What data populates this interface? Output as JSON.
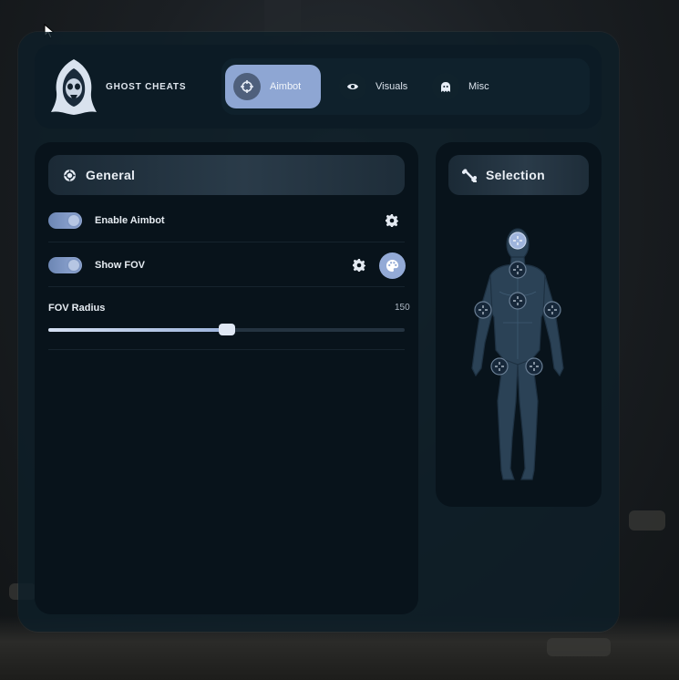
{
  "brand": {
    "name": "GHOST CHEATS"
  },
  "tabs": [
    {
      "label": "Aimbot",
      "icon": "crosshair-icon",
      "active": true
    },
    {
      "label": "Visuals",
      "icon": "eye-icon",
      "active": false
    },
    {
      "label": "Misc",
      "icon": "ghost-icon",
      "active": false
    }
  ],
  "general": {
    "title": "General",
    "enable_aimbot": {
      "label": "Enable Aimbot",
      "enabled": true
    },
    "show_fov": {
      "label": "Show FOV",
      "enabled": true
    },
    "fov_radius": {
      "label": "FOV Radius",
      "value": "150",
      "fraction": 0.5
    }
  },
  "selection": {
    "title": "Selection",
    "hitpoints": [
      "head",
      "neck",
      "chest",
      "left-arm",
      "right-arm",
      "left-leg",
      "right-leg"
    ]
  },
  "colors": {
    "accent": "#8ea6d3",
    "panel": "#08131b",
    "window": "#0e1e28"
  }
}
